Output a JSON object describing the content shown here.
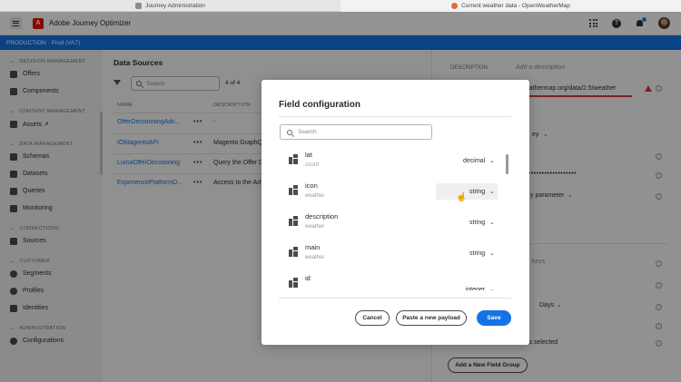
{
  "browser": {
    "tabs": [
      {
        "label": "Journey Administration"
      },
      {
        "label": "Current weather data - OpenWeatherMap"
      }
    ]
  },
  "app": {
    "title": "Adobe Journey Optimizer",
    "logo_letter": "A"
  },
  "env": {
    "label": "PRODUCTION · Prod (VA7)"
  },
  "sidenav": {
    "sections": [
      {
        "label": "DECISION MANAGEMENT",
        "items": [
          {
            "label": "Offers",
            "icon": "offers-icon"
          },
          {
            "label": "Components",
            "icon": "components-icon"
          }
        ]
      },
      {
        "label": "CONTENT MANAGEMENT",
        "items": [
          {
            "label": "Assets ↗",
            "icon": "assets-icon"
          }
        ]
      },
      {
        "label": "DATA MANAGEMENT",
        "items": [
          {
            "label": "Schemas",
            "icon": "schemas-icon"
          },
          {
            "label": "Datasets",
            "icon": "datasets-icon"
          },
          {
            "label": "Queries",
            "icon": "queries-icon"
          },
          {
            "label": "Monitoring",
            "icon": "monitoring-icon"
          }
        ]
      },
      {
        "label": "CONNECTIONS",
        "items": [
          {
            "label": "Sources",
            "icon": "sources-icon"
          }
        ]
      },
      {
        "label": "CUSTOMER",
        "items": [
          {
            "label": "Segments",
            "icon": "segments-icon"
          },
          {
            "label": "Profiles",
            "icon": "profiles-icon"
          },
          {
            "label": "Identities",
            "icon": "identities-icon"
          }
        ]
      },
      {
        "label": "ADMINISTRATION",
        "items": [
          {
            "label": "Configurations",
            "icon": "configurations-icon"
          }
        ]
      }
    ]
  },
  "main": {
    "title": "Data Sources",
    "search_placeholder": "Search",
    "count": "4 of 4",
    "columns": {
      "name": "NAME",
      "description": "DESCRIPTION"
    },
    "rows": [
      {
        "name": "OfferDecisioningAdv...",
        "more": "•••",
        "description": "-"
      },
      {
        "name": "IOMagentoAPI",
        "more": "•••",
        "description": "Magento GraphQ"
      },
      {
        "name": "LumaOfferDecisioning",
        "more": "•••",
        "description": "Query the Offer D"
      },
      {
        "name": "ExperiencePlatformD...",
        "more": "•••",
        "description": "Access to the Ad"
      }
    ]
  },
  "rpanel": {
    "description_label": "DESCRIPTION",
    "description_placeholder": "Add a description",
    "url_value": "enweathermap.org/data/2.5/weather",
    "type_value_1": "ey",
    "password_mask": "••••••••••••••••••••",
    "param_value": "y parameter",
    "partial_1": "keys",
    "days_label": "Days",
    "selected_label": "ls selected",
    "add_group_label": "Add a New Field Group"
  },
  "modal": {
    "title": "Field configuration",
    "search_placeholder": "Search",
    "fields": [
      {
        "name": "lat",
        "path": "coord",
        "type": "decimal"
      },
      {
        "name": "icon",
        "path": "weather",
        "type": "string"
      },
      {
        "name": "description",
        "path": "weather",
        "type": "string"
      },
      {
        "name": "main",
        "path": "weather",
        "type": "string"
      },
      {
        "name": "id",
        "path": "",
        "type": "integer"
      }
    ],
    "cancel_label": "Cancel",
    "paste_label": "Paste a new payload",
    "save_label": "Save"
  },
  "colors": {
    "accent": "#1473e6",
    "brand": "#eb1000",
    "error": "#d7373f"
  }
}
